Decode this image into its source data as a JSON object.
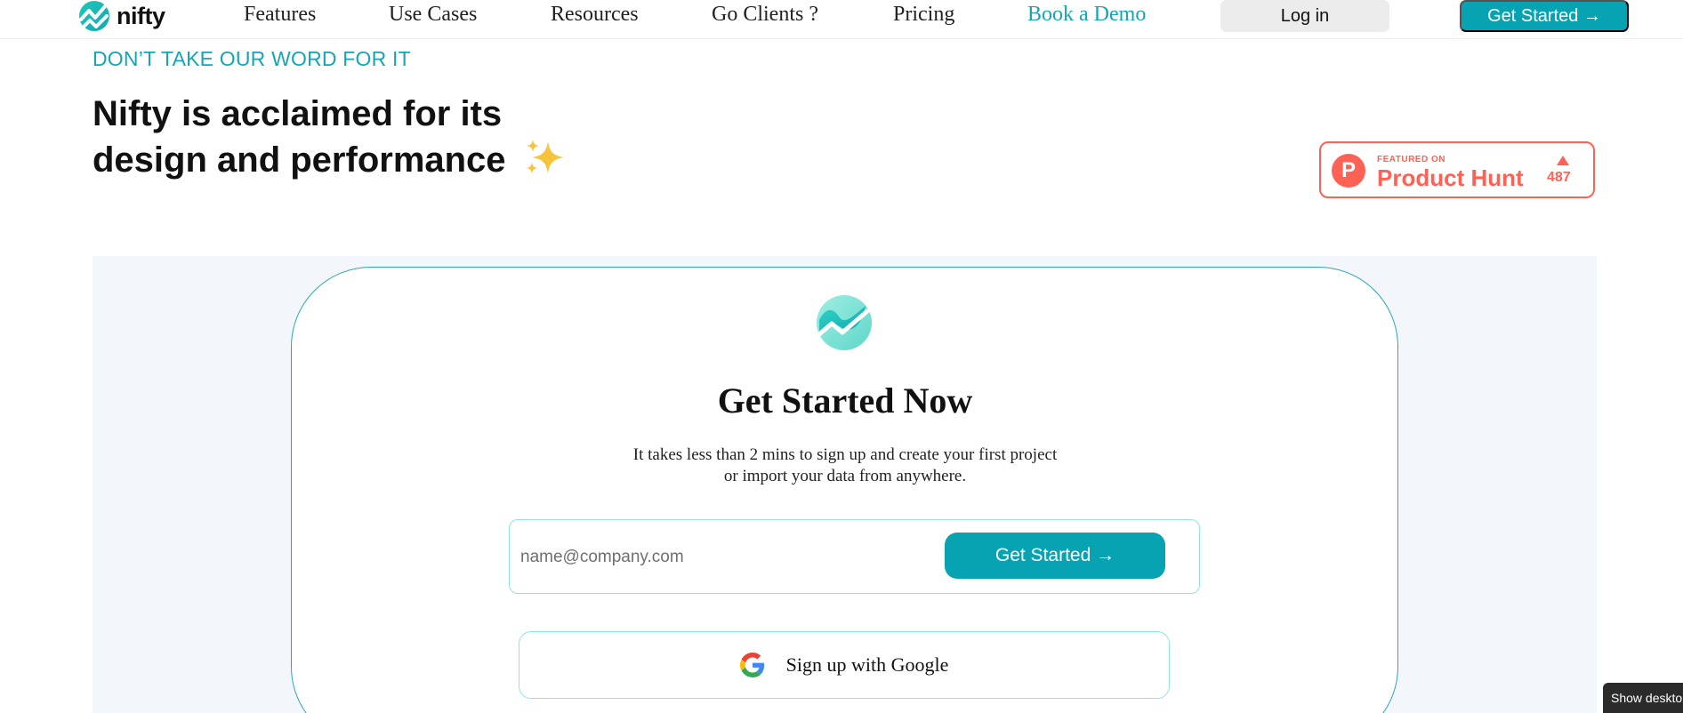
{
  "nav": {
    "logo_text": "nifty",
    "links": [
      "Features",
      "Use Cases",
      "Resources",
      "Go Clients ?",
      "Pricing"
    ],
    "demo_label": "Book a Demo",
    "login_label": "Log in",
    "cta_label": "Get Started →"
  },
  "hero": {
    "eyebrow": "DON’T TAKE OUR WORD FOR IT",
    "headline_line1": "Nifty is acclaimed for its",
    "headline_line2": "design and performance"
  },
  "product_hunt": {
    "logo_letter": "P",
    "featured_label": "FEATURED ON",
    "name": "Product Hunt",
    "upvotes": "487"
  },
  "signup": {
    "title": "Get Started Now",
    "subtitle_line1": "It takes less than 2 mins to sign up and create your first project",
    "subtitle_line2": "or import your data from anywhere.",
    "email_placeholder": "name@company.com",
    "cta_label": "Get Started →",
    "google_label": "Sign up with Google"
  },
  "toast": {
    "label": "Show deskto"
  },
  "colors": {
    "accent": "#07a3b2",
    "link_accent": "#17a5b5",
    "product_hunt": "#ff6154",
    "section_bg": "#f3f6fb",
    "input_border": "#8fe6e0"
  }
}
